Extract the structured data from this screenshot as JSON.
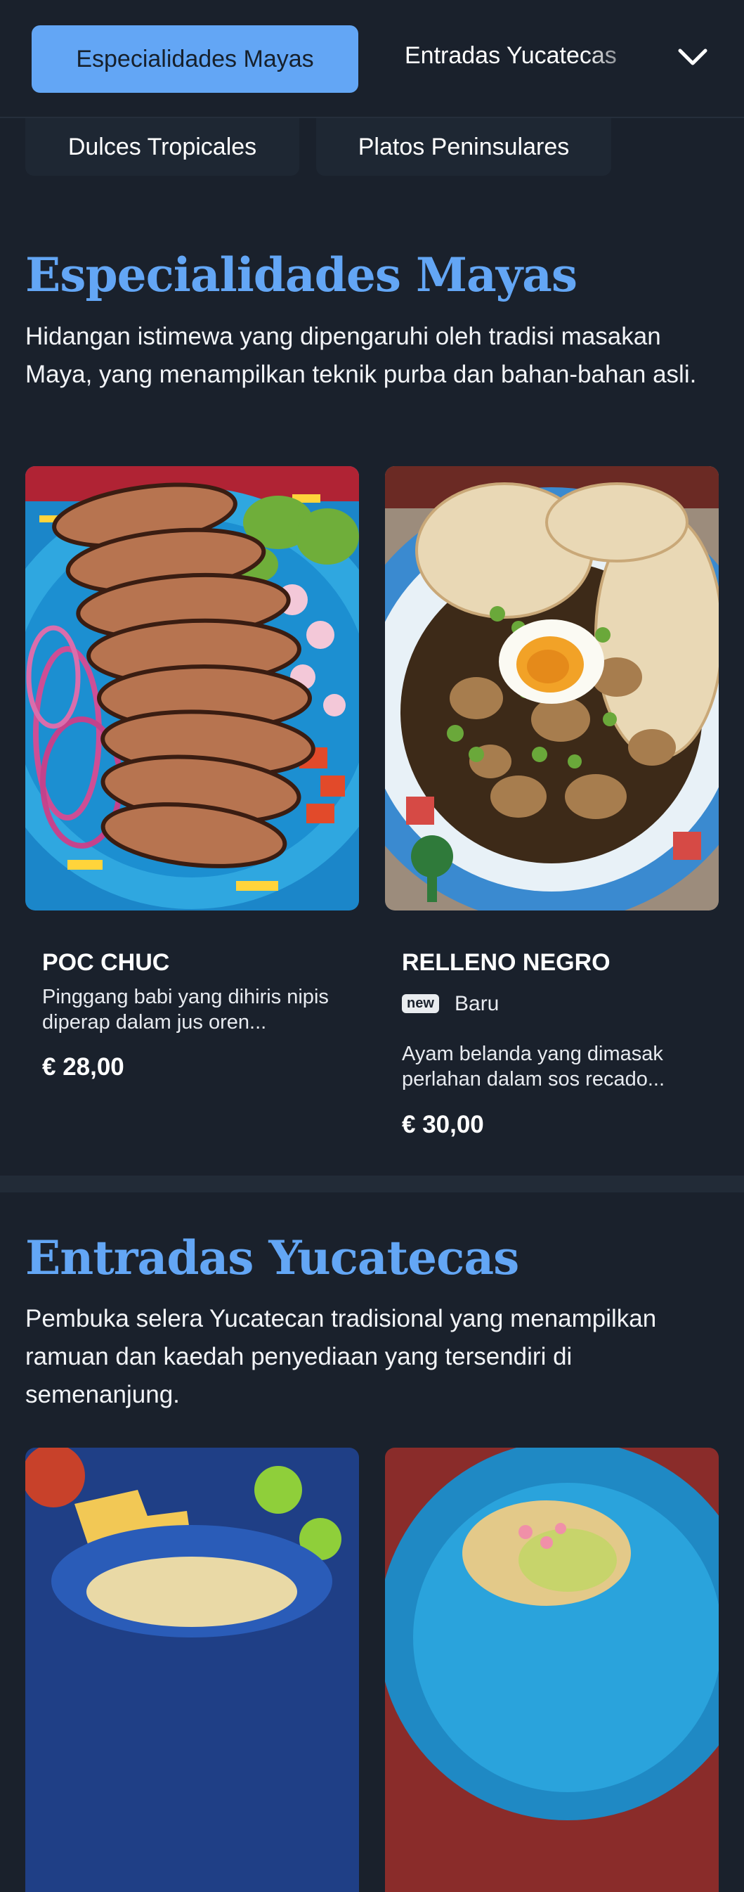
{
  "nav": {
    "active_category": "Especialidades Mayas",
    "categories": [
      "Especialidades Mayas",
      "Entradas Yucatecas",
      "Dulces Tropicales",
      "Platos Peninsulares"
    ]
  },
  "sections": [
    {
      "title": "Especialidades Mayas",
      "description": "Hidangan istimewa yang dipengaruhi oleh tradisi masakan Maya, yang menampilkan teknik purba dan bahan-bahan asli.",
      "items": [
        {
          "name": "POC CHUC",
          "description": "Pinggang babi yang dihiris nipis diperap dalam jus oren...",
          "price": "€ 28,00"
        },
        {
          "name": "RELLENO NEGRO",
          "badge": "new",
          "badge_label": "Baru",
          "description": "Ayam belanda yang dimasak perlahan dalam sos recado...",
          "price": "€ 30,00"
        }
      ]
    },
    {
      "title": "Entradas Yucatecas",
      "description": "Pembuka selera Yucatecan tradisional yang menampilkan ramuan dan kaedah penyediaan yang tersendiri di semenanjung."
    }
  ],
  "icons": {
    "dropdown": "chevron-down-icon"
  },
  "colors": {
    "accent": "#63a6f5",
    "background": "#1a212c"
  }
}
